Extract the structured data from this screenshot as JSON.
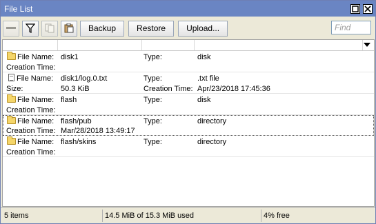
{
  "window": {
    "title": "File List"
  },
  "toolbar": {
    "backup_label": "Backup",
    "restore_label": "Restore",
    "upload_label": "Upload...",
    "find_placeholder": "Find"
  },
  "rows": [
    {
      "name_label": "File Name:",
      "name": "disk1",
      "type_label": "Type:",
      "type": "disk",
      "l2": "Creation Time:",
      "v2": "",
      "l3": "",
      "v3": "",
      "icon": "folder-icon"
    },
    {
      "name_label": "File Name:",
      "name": "disk1/log.0.txt",
      "type_label": "Type:",
      "type": ".txt file",
      "l2": "Size:",
      "v2": "50.3 KiB",
      "l3": "Creation Time:",
      "v3": "Apr/23/2018 17:45:36",
      "icon": "file-icon"
    },
    {
      "name_label": "File Name:",
      "name": "flash",
      "type_label": "Type:",
      "type": "disk",
      "l2": "Creation Time:",
      "v2": "",
      "l3": "",
      "v3": "",
      "icon": "folder-icon"
    },
    {
      "name_label": "File Name:",
      "name": "flash/pub",
      "type_label": "Type:",
      "type": "directory",
      "l2": "Creation Time:",
      "v2": "Mar/28/2018 13:49:17",
      "l3": "",
      "v3": "",
      "icon": "folder-icon"
    },
    {
      "name_label": "File Name:",
      "name": "flash/skins",
      "type_label": "Type:",
      "type": "directory",
      "l2": "Creation Time:",
      "v2": "",
      "l3": "",
      "v3": "",
      "icon": "folder-icon"
    }
  ],
  "status": {
    "items": "5 items",
    "usage": "14.5 MiB of 15.3 MiB used",
    "free": "4% free"
  }
}
